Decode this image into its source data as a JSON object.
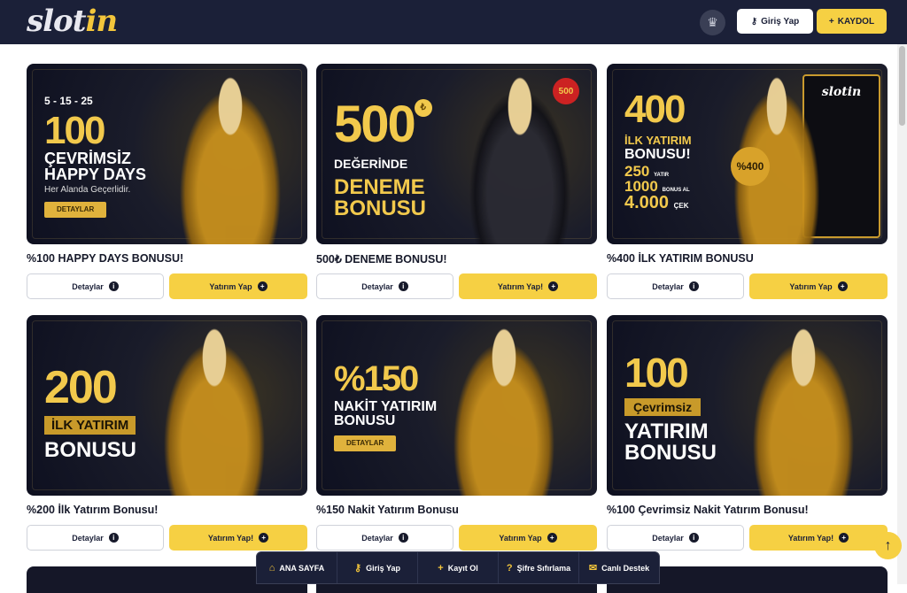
{
  "header": {
    "logo_a": "slot",
    "logo_b": "in",
    "login_label": "Giriş Yap",
    "register_label": "KAYDOL"
  },
  "promos": [
    {
      "title": "%100 HAPPY DAYS BONUSU!",
      "banner": {
        "top": "5 - 15 - 25",
        "big": "100",
        "line1": "ÇEVRİMSİZ",
        "line2": "HAPPY DAYS",
        "small": "Her Alanda Geçerlidir.",
        "pill": "DETAYLAR"
      },
      "details_label": "Detaylar",
      "invest_label": "Yatırım Yap"
    },
    {
      "title": "500₺ DENEME BONUSU!",
      "banner": {
        "big": "500",
        "coin": "₺",
        "line1": "DEĞERİNDE",
        "line2": "DENEME",
        "line3": "BONUSU",
        "badge": "500"
      },
      "details_label": "Detaylar",
      "invest_label": "Yatırım Yap!"
    },
    {
      "title": "%400 İLK YATIRIM BONUSU",
      "banner": {
        "big": "400",
        "line1": "İLK YATIRIM",
        "line2": "BONUSU!",
        "row1": "250",
        "row1_tag": "YATIR",
        "row2": "1000",
        "row2_tag": "BONUS AL",
        "row3": "4.000",
        "row3_tag": "ÇEK",
        "brand": "slotin",
        "badge": "%400"
      },
      "details_label": "Detaylar",
      "invest_label": "Yatırım Yap"
    },
    {
      "title": "%200 İlk Yatırım Bonusu!",
      "banner": {
        "big": "200",
        "line1": "İLK YATIRIM",
        "line2": "BONUSU"
      },
      "details_label": "Detaylar",
      "invest_label": "Yatırım Yap!"
    },
    {
      "title": "%150 Nakit Yatırım Bonusu",
      "banner": {
        "big": "%150",
        "line1": "NAKİT YATIRIM",
        "line2": "BONUSU",
        "pill": "DETAYLAR"
      },
      "details_label": "Detaylar",
      "invest_label": "Yatırım Yap"
    },
    {
      "title": "%100 Çevrimsiz Nakit Yatırım Bonusu!",
      "banner": {
        "big": "100",
        "line1": "Çevrimsiz",
        "line2": "YATIRIM",
        "line3": "BONUSU"
      },
      "details_label": "Detaylar",
      "invest_label": "Yatırım Yap!"
    }
  ],
  "bottom_nav": [
    {
      "label": "ANA SAYFA",
      "icon": "home-icon"
    },
    {
      "label": "Giriş Yap",
      "icon": "key-icon"
    },
    {
      "label": "Kayıt Ol",
      "icon": "plus-icon"
    },
    {
      "label": "Şifre Sıfırlama",
      "icon": "question-icon"
    },
    {
      "label": "Canlı Destek",
      "icon": "chat-icon"
    }
  ],
  "colors": {
    "header_bg": "#1b2038",
    "accent": "#f6d043",
    "text": "#16192a"
  }
}
